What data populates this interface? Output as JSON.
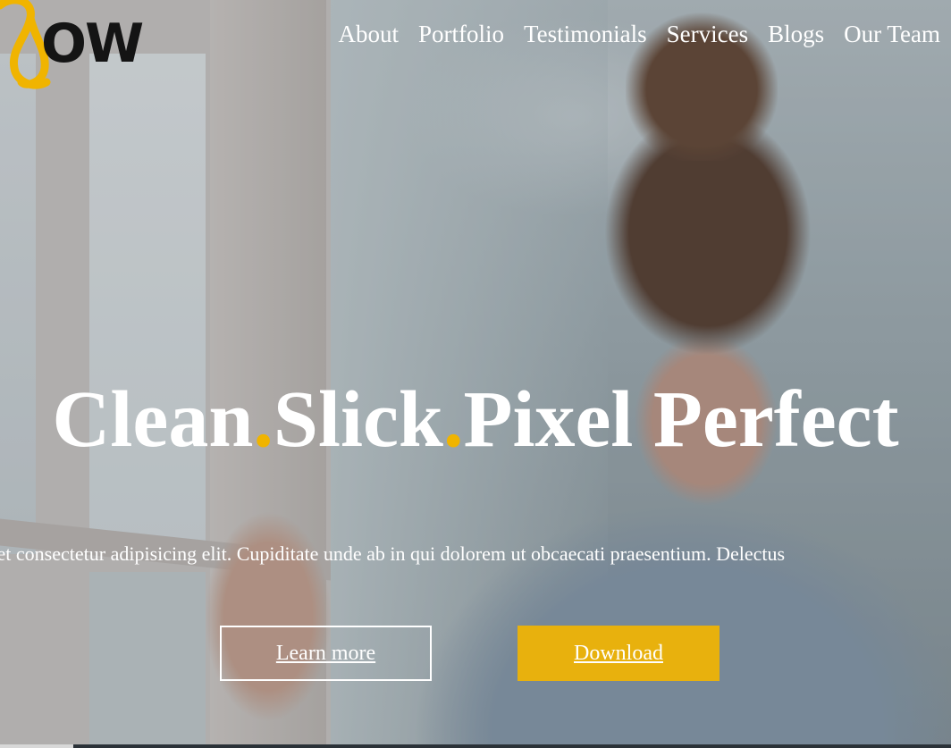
{
  "brand": {
    "logo_text": "OW",
    "logo_color": "#f0b400"
  },
  "nav": {
    "items": [
      {
        "label": "About"
      },
      {
        "label": "Portfolio"
      },
      {
        "label": "Testimonials"
      },
      {
        "label": "Services"
      },
      {
        "label": "Blogs"
      },
      {
        "label": "Our Team"
      }
    ]
  },
  "hero": {
    "headline": {
      "word1": "Clean",
      "sep1": ".",
      "word2": "Slick",
      "sep2": ".",
      "word3": "Pixel Perfect"
    },
    "subtext": "Lorem ipsum dolor sit amet consectetur adipisicing elit. Cupiditate unde ab in qui dolorem ut obcaecati praesentium. Delectus",
    "buttons": {
      "learn_more": "Learn more",
      "download": "Download"
    },
    "accent_color": "#e8b10d"
  }
}
